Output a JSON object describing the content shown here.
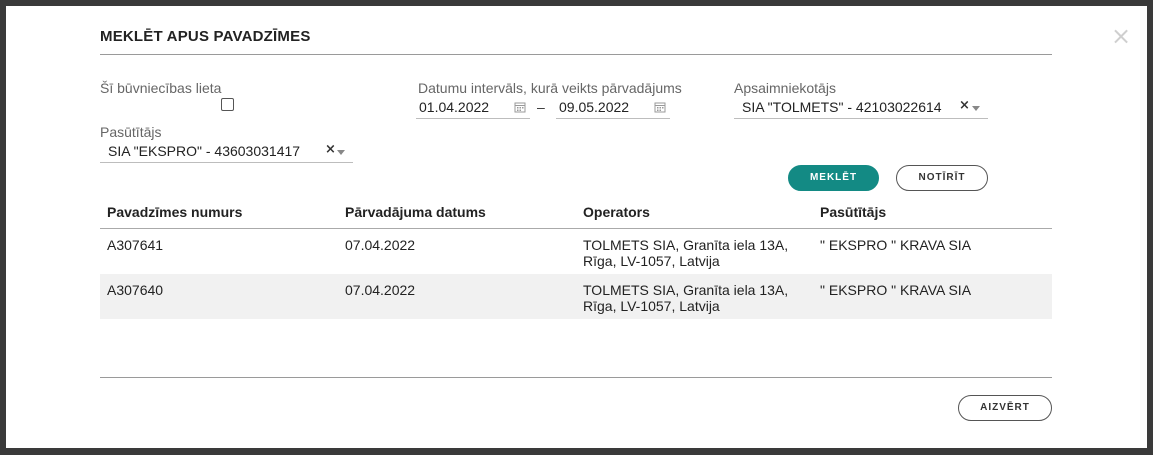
{
  "modal": {
    "title": "MEKLĒT APUS PAVADZĪMES",
    "close_icon": "close-icon"
  },
  "filters": {
    "building_case_label": "Šī būvniecības lieta",
    "building_case_checked": false,
    "date_range_label": "Datumu intervāls, kurā veikts pārvadājums",
    "date_from": "01.04.2022",
    "date_separator": "–",
    "date_to": "09.05.2022",
    "manager_label": "Apsaimniekotājs",
    "manager_value": "SIA \"TOLMETS\" - 42103022614",
    "customer_label": "Pasūtītājs",
    "customer_value": "SIA \"EKSPRO\" - 43603031417",
    "clear_symbol": "×"
  },
  "actions": {
    "search_label": "MEKLĒT",
    "clear_label": "NOTĪRĪT",
    "close_label": "AIZVĒRT"
  },
  "table": {
    "columns": [
      "Pavadzīmes numurs",
      "Pārvadājuma datums",
      "Operators",
      "Pasūtītājs"
    ],
    "rows": [
      {
        "number": "A307641",
        "date": "07.04.2022",
        "operator_line1": "TOLMETS SIA, Granīta iela 13A,",
        "operator_line2": "Rīga, LV-1057, Latvija",
        "customer": "\" EKSPRO \" KRAVA SIA"
      },
      {
        "number": "A307640",
        "date": "07.04.2022",
        "operator_line1": "TOLMETS SIA, Granīta iela 13A,",
        "operator_line2": "Rīga, LV-1057, Latvija",
        "customer": "\" EKSPRO \" KRAVA SIA"
      }
    ]
  },
  "colors": {
    "accent": "#138a84",
    "row_alt": "#f1f1f1",
    "overlay": "#3a3a3a"
  }
}
